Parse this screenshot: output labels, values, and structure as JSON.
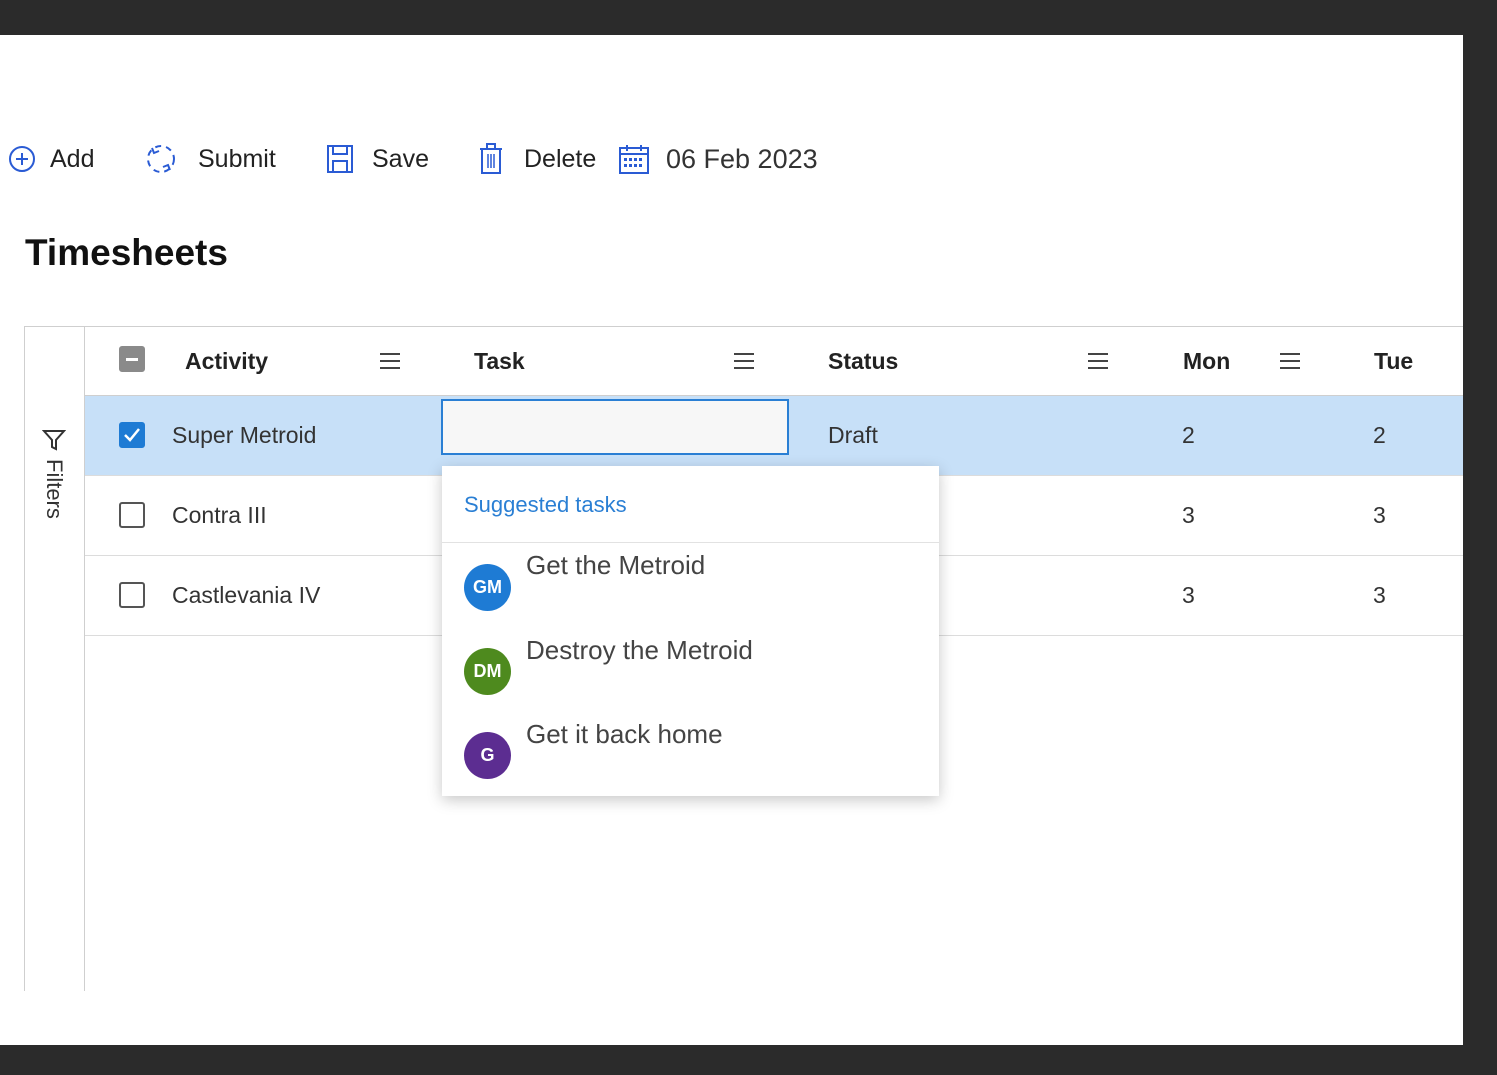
{
  "toolbar": {
    "add_label": "Add",
    "submit_label": "Submit",
    "save_label": "Save",
    "delete_label": "Delete",
    "date_value": "06 Feb 2023"
  },
  "page": {
    "title": "Timesheets"
  },
  "filters": {
    "label": "Filters"
  },
  "columns": {
    "activity": "Activity",
    "task": "Task",
    "status": "Status",
    "mon": "Mon",
    "tue": "Tue"
  },
  "rows": [
    {
      "activity": "Super Metroid",
      "status": "Draft",
      "mon": "2",
      "tue": "2",
      "checked": true
    },
    {
      "activity": "Contra III",
      "status": "",
      "mon": "3",
      "tue": "3",
      "checked": false
    },
    {
      "activity": "Castlevania IV",
      "status": "",
      "mon": "3",
      "tue": "3",
      "checked": false
    }
  ],
  "task_input": {
    "value": "",
    "placeholder": ""
  },
  "suggestions": {
    "header": "Suggested tasks",
    "items": [
      {
        "initials": "GM",
        "label": "Get the Metroid",
        "color": "#1e7bd4"
      },
      {
        "initials": "DM",
        "label": "Destroy the Metroid",
        "color": "#4e8a1e"
      },
      {
        "initials": "G",
        "label": "Get it back home",
        "color": "#5c2d91"
      }
    ]
  },
  "colors": {
    "accent": "#2a7fd4",
    "selected_row": "#c7e0f8",
    "frame": "#2b2b2b"
  }
}
